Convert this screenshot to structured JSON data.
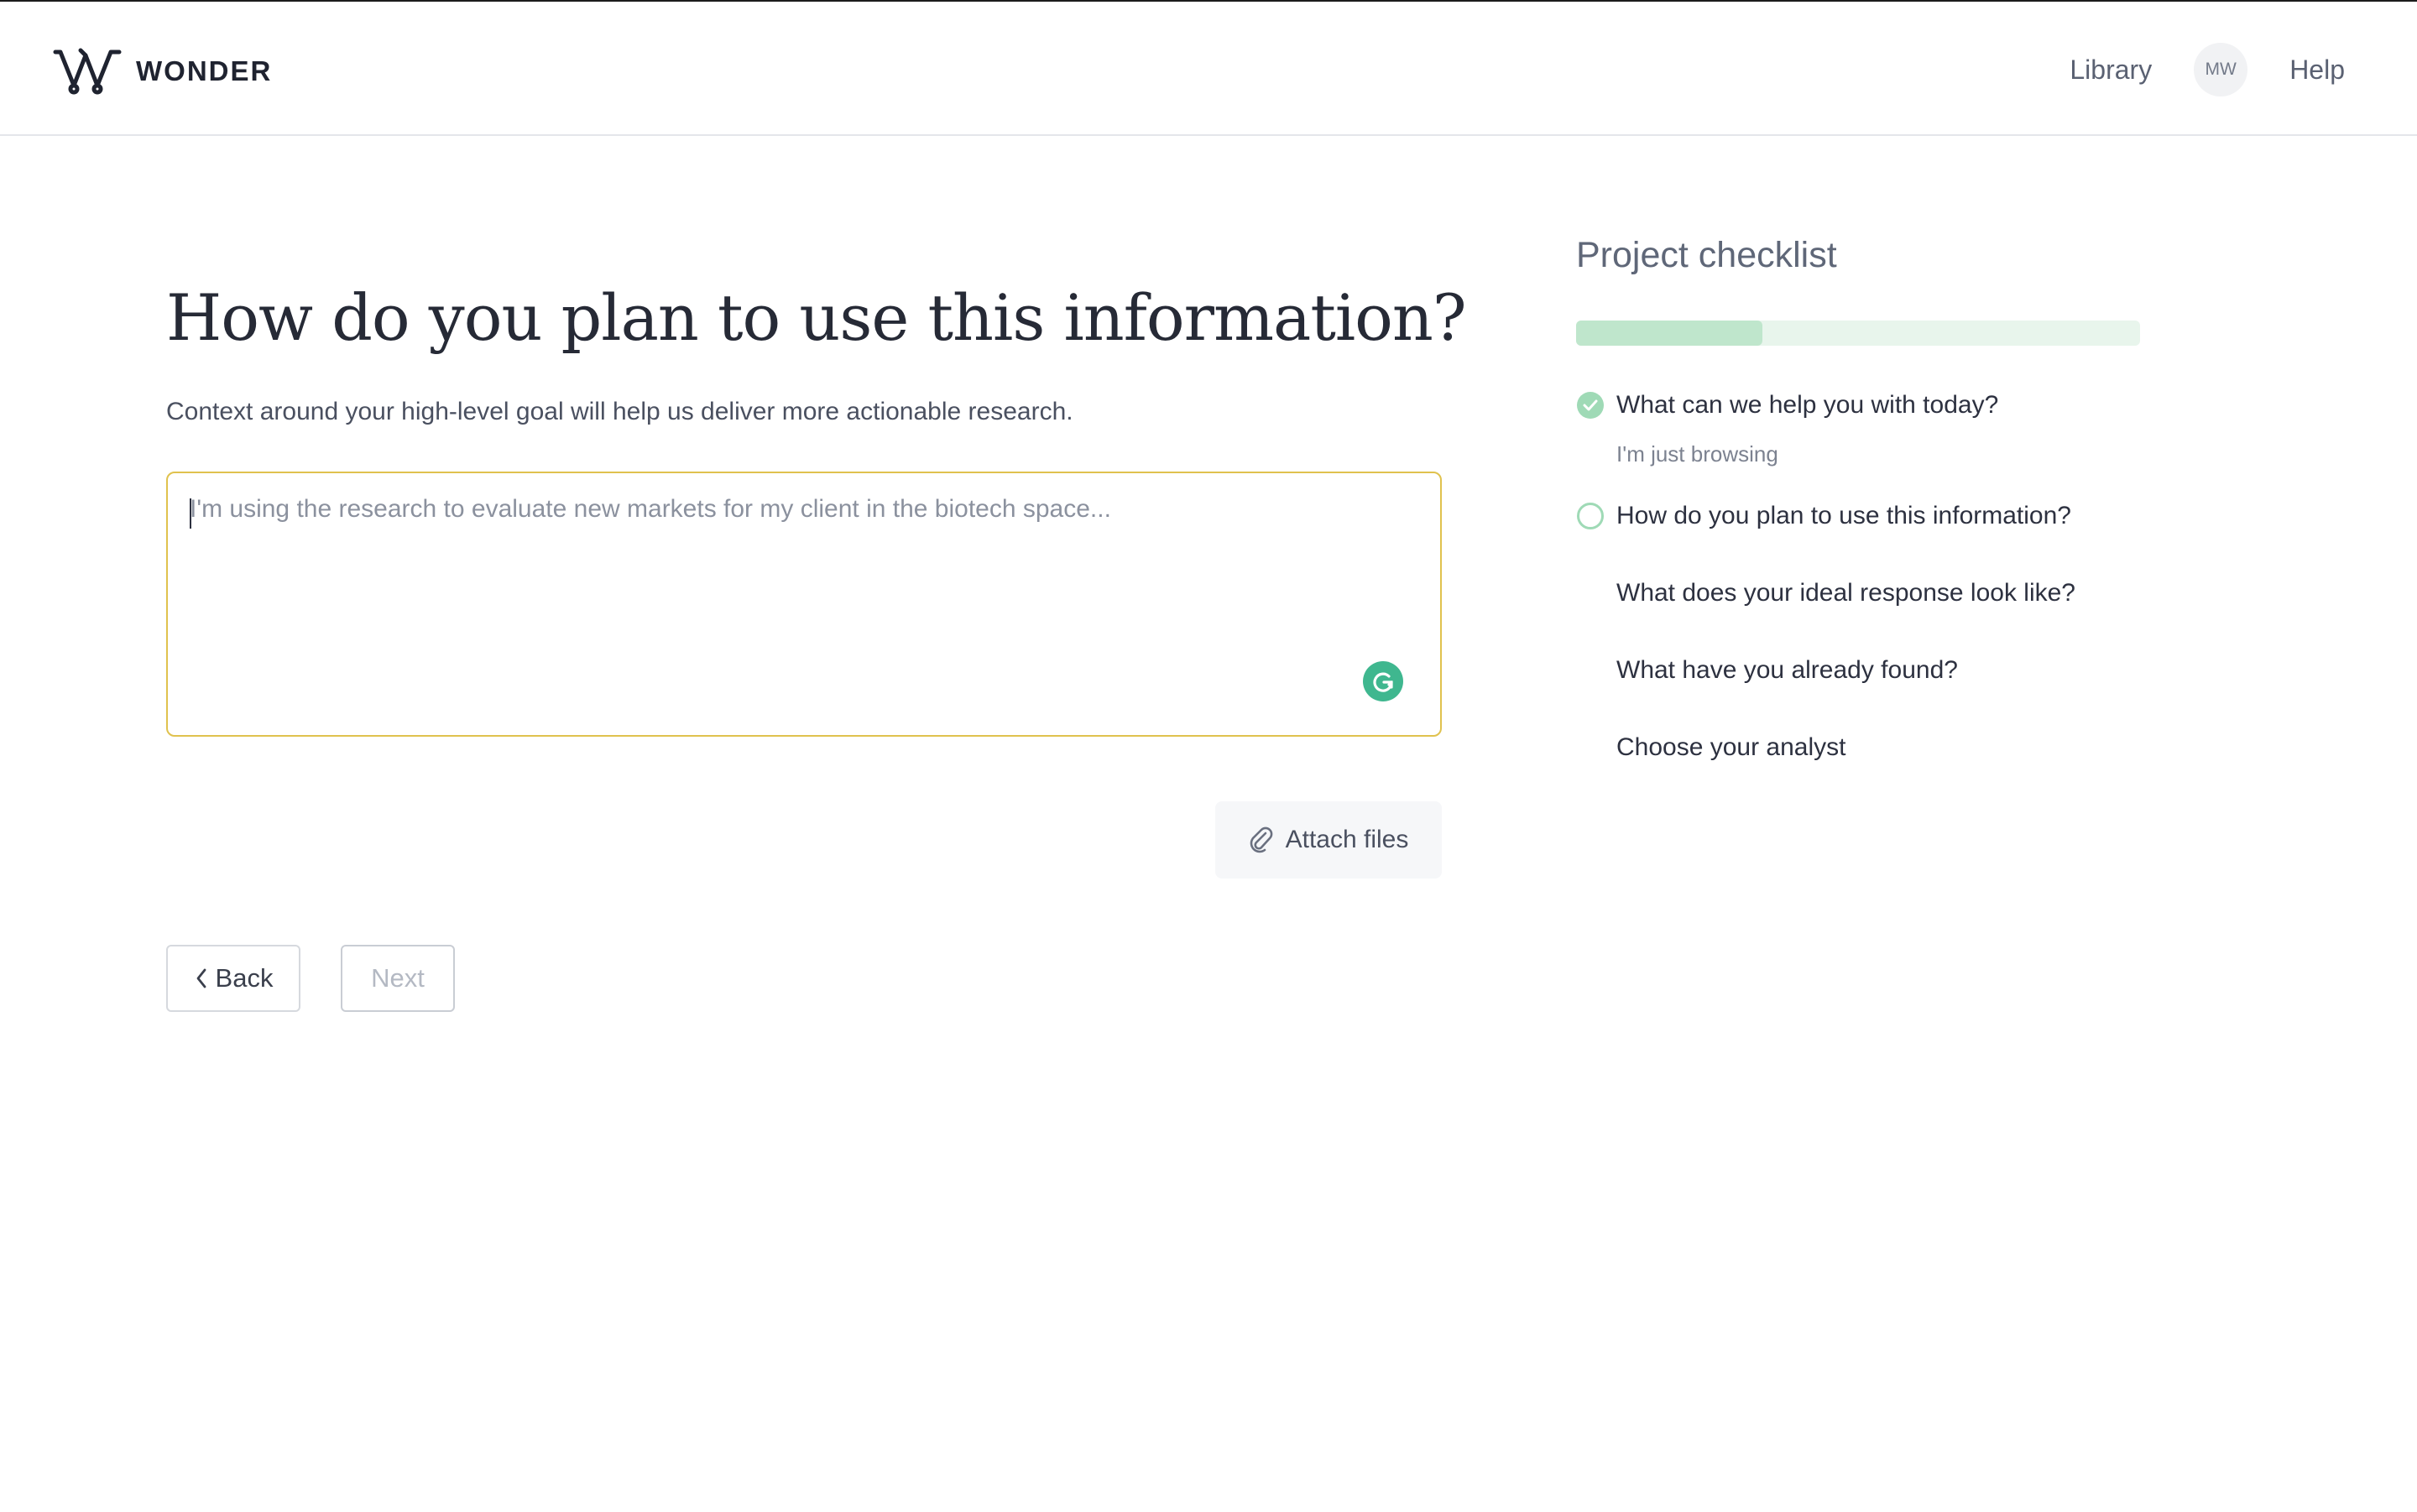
{
  "header": {
    "brand": "WONDER",
    "nav": {
      "library": "Library",
      "avatar_initials": "MW",
      "help": "Help"
    }
  },
  "main": {
    "title": "How do you plan to use this information?",
    "subtitle": "Context around your high-level goal will help us deliver more actionable research.",
    "goal_input": {
      "value": "",
      "placeholder": "I'm using the research to evaluate new markets for my client in the biotech space..."
    },
    "attach_label": "Attach files",
    "back_label": "Back",
    "next_label": "Next"
  },
  "checklist": {
    "title": "Project checklist",
    "progress_fraction": 0.33,
    "items": [
      {
        "label": "What can we help you with today?",
        "status": "done",
        "answer": "I'm just browsing"
      },
      {
        "label": "How do you plan to use this information?",
        "status": "current"
      },
      {
        "label": "What does your ideal response look like?",
        "status": "pending"
      },
      {
        "label": "What have you already found?",
        "status": "pending"
      },
      {
        "label": "Choose your analyst",
        "status": "pending"
      }
    ]
  },
  "colors": {
    "accent_green": "#9fdab6",
    "input_border": "#e0c24e",
    "grammarly": "#3fb78f"
  },
  "icons": {
    "logo": "wonder-logo-icon",
    "grammarly": "grammarly-icon",
    "attach": "paperclip-icon",
    "back": "chevron-left-icon",
    "done": "check-circle-icon",
    "current": "empty-circle-icon"
  }
}
